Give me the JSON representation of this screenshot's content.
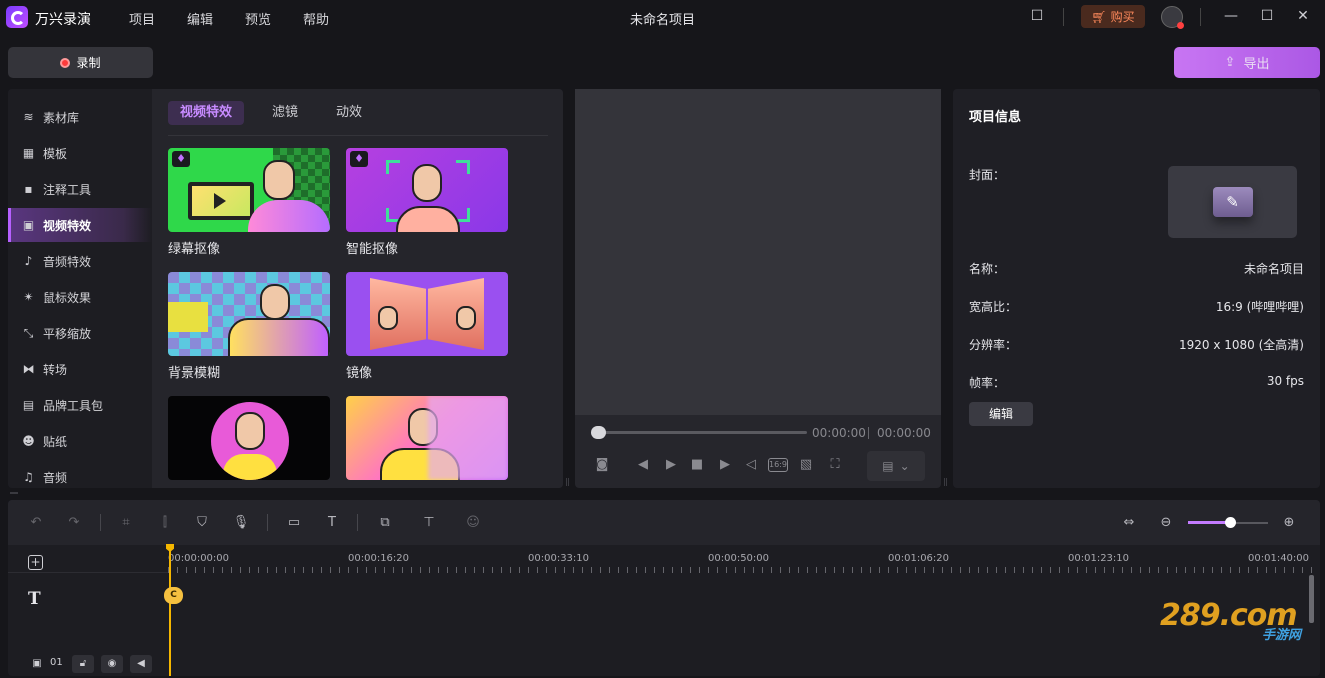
{
  "app": {
    "name": "万兴录演",
    "window_title": "未命名项目",
    "buy_label": "购买"
  },
  "menu": [
    "项目",
    "编辑",
    "预览",
    "帮助"
  ],
  "toolbar": {
    "record_label": "录制",
    "export_label": "导出"
  },
  "sidebar": {
    "items": [
      {
        "label": "素材库",
        "icon": "layers-icon"
      },
      {
        "label": "模板",
        "icon": "template-icon"
      },
      {
        "label": "注释工具",
        "icon": "comment-icon"
      },
      {
        "label": "视频特效",
        "icon": "video-effects-icon",
        "active": true
      },
      {
        "label": "音频特效",
        "icon": "music-note-icon"
      },
      {
        "label": "鼠标效果",
        "icon": "cursor-click-icon"
      },
      {
        "label": "平移缩放",
        "icon": "pan-zoom-icon"
      },
      {
        "label": "转场",
        "icon": "transition-icon"
      },
      {
        "label": "品牌工具包",
        "icon": "briefcase-icon"
      },
      {
        "label": "贴纸",
        "icon": "sticker-icon"
      },
      {
        "label": "音频",
        "icon": "audio-icon"
      }
    ]
  },
  "content": {
    "tabs": [
      {
        "label": "视频特效",
        "active": true
      },
      {
        "label": "滤镜",
        "active": false
      },
      {
        "label": "动效",
        "active": false
      }
    ],
    "cards": [
      {
        "label": "绿幕抠像",
        "premium": true
      },
      {
        "label": "智能抠像",
        "premium": true
      },
      {
        "label": "背景模糊",
        "premium": false
      },
      {
        "label": "镜像",
        "premium": false
      },
      {
        "label": "",
        "premium": false
      },
      {
        "label": "",
        "premium": false
      }
    ]
  },
  "preview": {
    "current_time": "00:00:00",
    "total_time": "00:00:00",
    "progress": 0,
    "aspect_label": "16:9"
  },
  "project_info": {
    "title": "项目信息",
    "cover_label": "封面：",
    "rows": [
      {
        "label": "名称：",
        "value": "未命名项目"
      },
      {
        "label": "宽高比：",
        "value": "16:9 (哔哩哔哩)"
      },
      {
        "label": "分辨率：",
        "value": "1920 x 1080 (全高清)"
      },
      {
        "label": "帧率：",
        "value": "30 fps"
      }
    ],
    "edit_label": "编辑"
  },
  "timeline": {
    "ruler_labels": [
      "00:00:00:00",
      "00:00:16:20",
      "00:00:33:10",
      "00:00:50:00",
      "00:01:06:20",
      "00:01:23:10",
      "00:01:40:00"
    ],
    "track_number": "01",
    "zoom_level": 0.52
  },
  "watermark": {
    "main": "289.com",
    "sub": "手游网"
  },
  "colors": {
    "accent": "#b660ff",
    "playhead": "#f5b700",
    "record": "#ff3b3b",
    "buy": "#ff8a5c"
  }
}
